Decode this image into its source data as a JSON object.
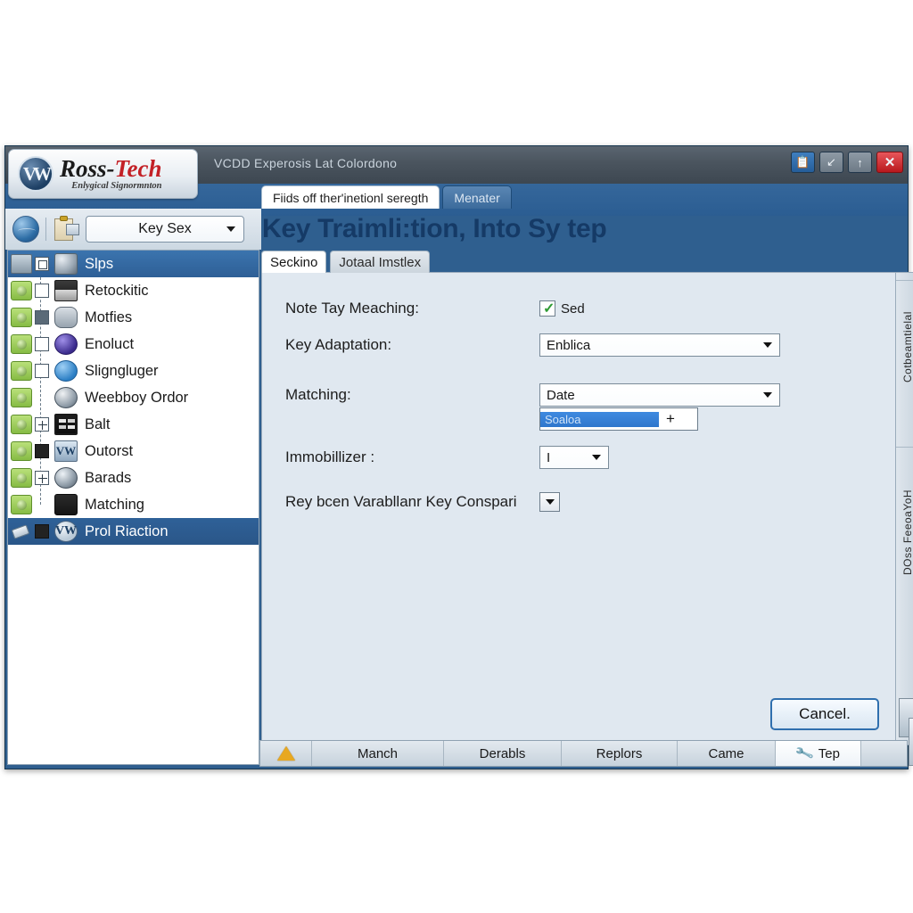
{
  "window": {
    "title": "VCDD Experosis Lat Colordono",
    "brand_main_left": "Ross-",
    "brand_main_right": "Tech",
    "brand_sub": "Enlygical Signormnton",
    "vw_badge": "VW"
  },
  "window_controls": [
    {
      "name": "clipboard-window-button",
      "glyph": "📋"
    },
    {
      "name": "minimize-window-button",
      "glyph": "↙"
    },
    {
      "name": "restore-window-button",
      "glyph": "↑"
    },
    {
      "name": "close-window-button",
      "glyph": "✕"
    }
  ],
  "top_tabs": [
    {
      "label": "Fiids off ther'inetionl seregth",
      "active": true
    },
    {
      "label": "Menater",
      "active": false
    }
  ],
  "toolbar": {
    "module_select_value": "Key Sex",
    "globe_icon": "globe-icon",
    "clipboard_icon": "clipboard-icon"
  },
  "tree": {
    "root": {
      "label": "Slps",
      "icon": "train-icon",
      "selected": true
    },
    "items": [
      {
        "label": "Retockitic",
        "icon": "printer-icon"
      },
      {
        "label": "Motfies",
        "icon": "probe-icon"
      },
      {
        "label": "Enoluct",
        "icon": "bulb-icon"
      },
      {
        "label": "Sligngluger",
        "icon": "info-icon"
      },
      {
        "label": "Weebboy Ordor",
        "icon": "gear-icon"
      },
      {
        "label": "Balt",
        "icon": "panel-icon"
      },
      {
        "label": "Outorst",
        "icon": "vw-icon"
      },
      {
        "label": "Barads",
        "icon": "snowflake-icon"
      },
      {
        "label": "Matching",
        "icon": "wrench-icon"
      }
    ],
    "footer": {
      "label": "Prol Riaction",
      "icon": "vw-icon",
      "selected": true
    }
  },
  "page": {
    "title": "Key Traimli:tion, Into Sy tep"
  },
  "subtabs": [
    {
      "label": "Seckino",
      "active": true
    },
    {
      "label": "Jotaal Imstlex",
      "active": false
    }
  ],
  "form": {
    "rows": [
      {
        "label": "Note Tay Meaching:",
        "control": "checkbox",
        "checked_label": "Sed"
      },
      {
        "label": "Key Adaptation:",
        "control": "combo",
        "value": "Enblica"
      },
      {
        "label": "Matching:",
        "control": "combo",
        "value": "Date"
      },
      {
        "label": "Immobillizer :",
        "control": "combo",
        "value": "I"
      },
      {
        "label": "Rey bcen Varabllanr Key Conspari",
        "control": "minibutton"
      }
    ],
    "dropdown_item": "Soaloa",
    "dropdown_plus": "+",
    "cancel_label": "Cancel."
  },
  "vertical_tabs": [
    {
      "label": "Cotbeamtielal"
    },
    {
      "label": "DOss FeeoaYoH"
    }
  ],
  "statusbar": {
    "warning_icon": "warning-triangle-icon",
    "cells": [
      {
        "label": "Manch",
        "active": false
      },
      {
        "label": "Derabls",
        "active": false
      },
      {
        "label": "Replors",
        "active": false
      },
      {
        "label": "Came",
        "active": false
      },
      {
        "label": "Tep",
        "active": true,
        "icon": "wrench-icon"
      }
    ]
  },
  "colors": {
    "window_chrome": "#2f5f8f",
    "titlebar": "#4a545e",
    "accent_blue": "#2f76cc",
    "panel_bg": "#e0e8f0",
    "title_text": "#153a66",
    "close_red": "#b8181d",
    "check_green": "#2f9b34",
    "warning_amber": "#e8a820"
  }
}
